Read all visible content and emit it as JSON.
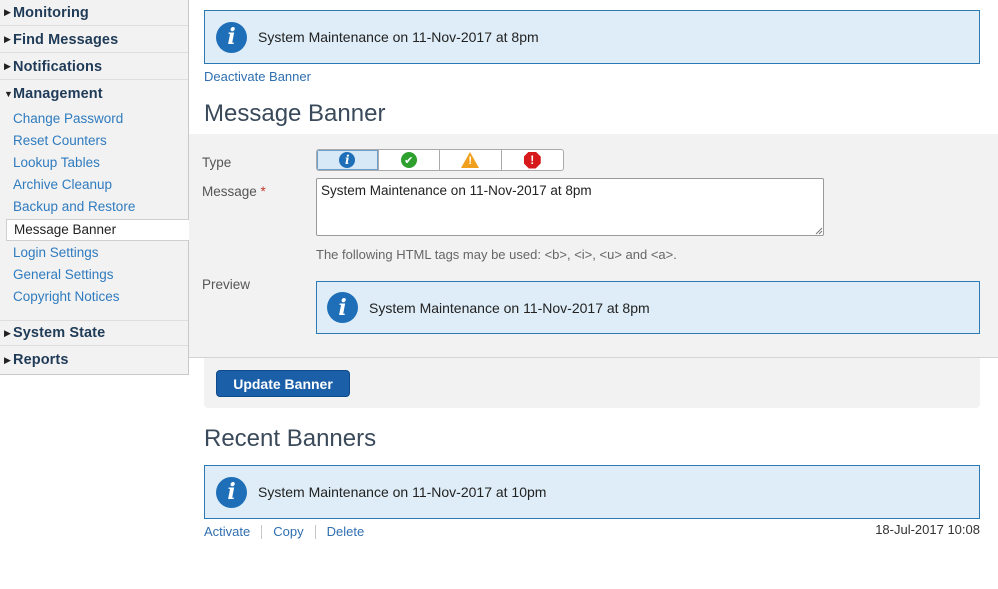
{
  "sidebar": {
    "sections": [
      {
        "label": "Monitoring",
        "arrow": "▶"
      },
      {
        "label": "Find Messages",
        "arrow": "▶"
      },
      {
        "label": "Notifications",
        "arrow": "▶"
      },
      {
        "label": "Management",
        "arrow": "▼"
      }
    ],
    "management_items": [
      "Change Password",
      "Reset Counters",
      "Lookup Tables",
      "Archive Cleanup",
      "Backup and Restore",
      "Message Banner",
      "Login Settings",
      "General Settings",
      "Copyright Notices"
    ],
    "active_item": "Message Banner",
    "bottom_sections": [
      {
        "label": "System State",
        "arrow": "▶"
      },
      {
        "label": "Reports",
        "arrow": "▶"
      }
    ]
  },
  "current_banner": {
    "icon": "info-icon",
    "text": "System Maintenance on 11-Nov-2017 at 8pm"
  },
  "deactivate_link": "Deactivate Banner",
  "form": {
    "heading": "Message Banner",
    "type_label": "Type",
    "type_options": [
      "info-icon",
      "success-check-icon",
      "warning-triangle-icon",
      "error-stop-icon"
    ],
    "type_selected": "info-icon",
    "message_label": "Message",
    "required_mark": "*",
    "message_value": "System Maintenance on 11-Nov-2017 at 8pm",
    "hint": "The following HTML tags may be used: <b>, <i>, <u> and <a>.",
    "preview_label": "Preview",
    "preview_text": "System Maintenance on 11-Nov-2017 at 8pm",
    "update_button": "Update Banner"
  },
  "recent": {
    "heading": "Recent Banners",
    "items": [
      {
        "text": "System Maintenance on 11-Nov-2017 at 10pm",
        "actions": [
          "Activate",
          "Copy",
          "Delete"
        ],
        "date": "18-Jul-2017 10:08"
      }
    ]
  },
  "colors": {
    "brand_blue": "#1e6fb8",
    "banner_bg": "#deedf7",
    "button_blue": "#1a5fa8",
    "link": "#2f6fb0"
  }
}
